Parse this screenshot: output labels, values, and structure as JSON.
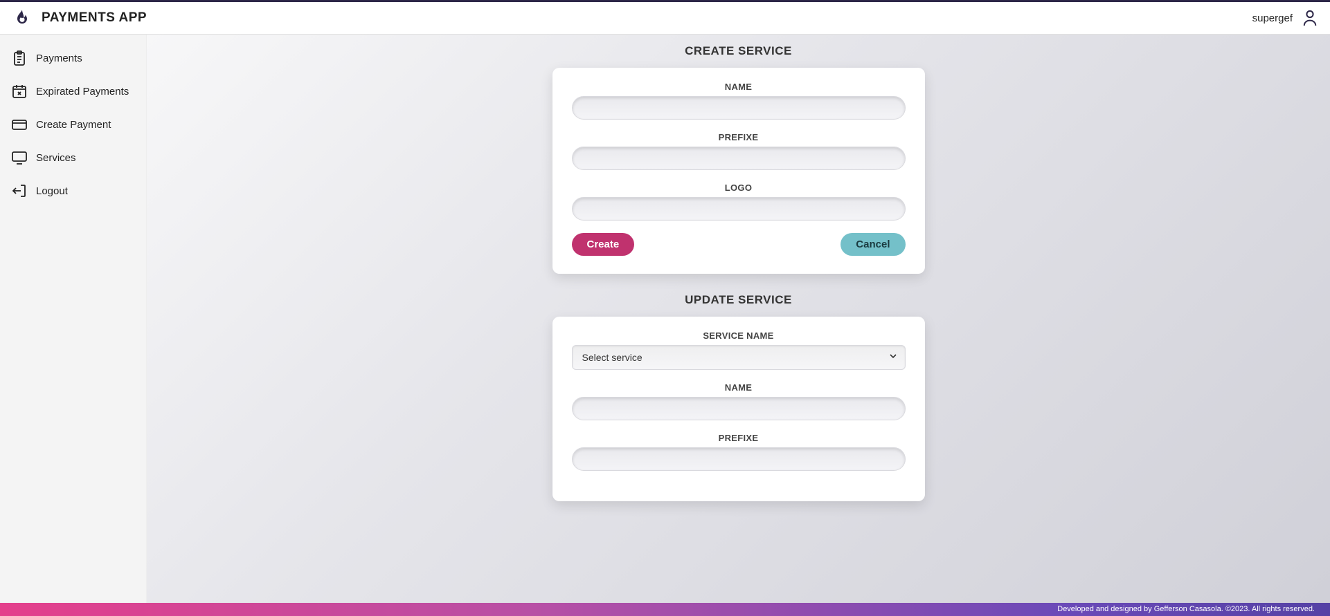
{
  "header": {
    "app_title": "PAYMENTS APP",
    "username": "supergef"
  },
  "sidebar": {
    "items": [
      {
        "label": "Payments",
        "icon": "clipboard-icon"
      },
      {
        "label": "Expirated Payments",
        "icon": "calendar-x-icon"
      },
      {
        "label": "Create Payment",
        "icon": "card-icon"
      },
      {
        "label": "Services",
        "icon": "monitor-icon"
      },
      {
        "label": "Logout",
        "icon": "logout-icon"
      }
    ]
  },
  "main": {
    "create_service": {
      "title": "CREATE SERVICE",
      "name_label": "NAME",
      "name_value": "",
      "prefixe_label": "PREFIXE",
      "prefixe_value": "",
      "logo_label": "LOGO",
      "logo_value": "",
      "create_button": "Create",
      "cancel_button": "Cancel"
    },
    "update_service": {
      "title": "UPDATE SERVICE",
      "service_name_label": "SERVICE NAME",
      "service_select_placeholder": "Select service",
      "name_label": "NAME",
      "name_value": "",
      "prefixe_label": "PREFIXE",
      "prefixe_value": ""
    }
  },
  "footer": {
    "text": "Developed and designed by Gefferson Casasola. ©2023. All rights reserved."
  },
  "colors": {
    "primary_button": "#c0326e",
    "secondary_button": "#74c0c9",
    "topbar_border": "#2d2748",
    "footer_gradient_start": "#e43f8b",
    "footer_gradient_end": "#5542a5"
  }
}
